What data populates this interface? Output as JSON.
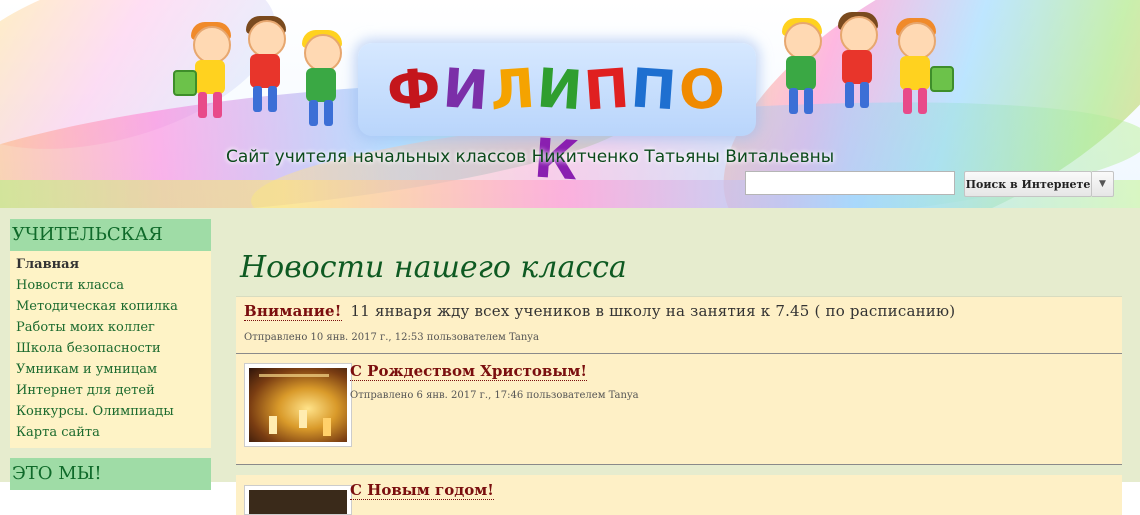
{
  "header": {
    "logo_letters": [
      "Ф",
      "И",
      "Л",
      "И",
      "П",
      "П",
      "О",
      "К"
    ],
    "logo_colors": [
      "#c4161c",
      "#7b2fa8",
      "#f5a300",
      "#2f9e2f",
      "#e02020",
      "#1e6fd0",
      "#f08a00",
      "#8a1fb0"
    ],
    "subtitle": "Сайт учителя начальных классов Никитченко Татьяны Витальевны"
  },
  "search": {
    "value": "",
    "placeholder": "",
    "button_label": "Поиск в Интернете",
    "dropdown_icon": "triangle-down-icon"
  },
  "sidebar": {
    "section1_title": "УЧИТЕЛЬСКАЯ",
    "items": [
      {
        "label": "Главная",
        "active": true
      },
      {
        "label": "Новости класса"
      },
      {
        "label": "Методическая копилка"
      },
      {
        "label": "Работы моих коллег"
      },
      {
        "label": "Школа безопасности"
      },
      {
        "label": "Умникам и умницам"
      },
      {
        "label": "Интернет для детей"
      },
      {
        "label": "Конкурсы. Олимпиады"
      },
      {
        "label": "Карта сайта"
      }
    ],
    "section2_title": "ЭТО МЫ!"
  },
  "main": {
    "title": "Новости нашего класса",
    "posts": [
      {
        "title": "Внимание!",
        "text": "11 января жду всех учеников в школу на занятия к 7.45 ( по расписанию)",
        "meta": "Отправлено 10 янв. 2017 г., 12:53 пользователем Tanya"
      },
      {
        "title": "С Рождеством Христовым!",
        "meta": "Отправлено 6 янв. 2017 г., 17:46 пользователем Tanya"
      },
      {
        "title": "С Новым годом!"
      }
    ]
  },
  "colors": {
    "accent_green": "#0e5a22",
    "sidebar_header": "#9fdca6",
    "post_bg": "#fef0c6",
    "link_red": "#7a0e0e"
  }
}
